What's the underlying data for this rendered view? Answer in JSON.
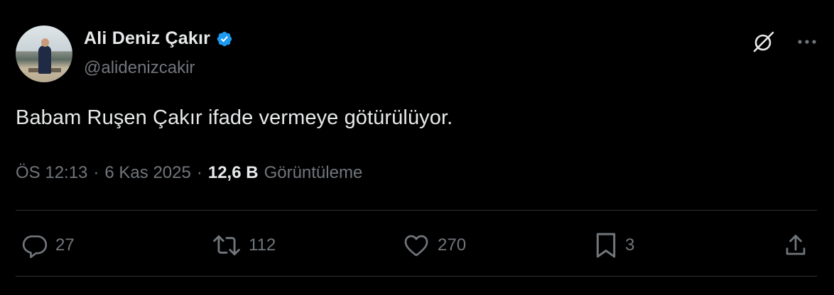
{
  "author": {
    "display_name": "Ali Deniz Çakır",
    "handle": "@alidenizcakir",
    "verified": true
  },
  "tweet": {
    "text": "Babam Ruşen Çakır ifade vermeye götürülüyor."
  },
  "meta": {
    "time": "ÖS 12:13",
    "separator": "·",
    "date": "6 Kas 2025",
    "views_count": "12,6 B",
    "views_label": "Görüntüleme"
  },
  "actions": {
    "replies": "27",
    "reposts": "112",
    "likes": "270",
    "bookmarks": "3"
  },
  "icons": {
    "verified": "verified-badge-icon",
    "grok": "grok-icon",
    "more": "more-icon",
    "reply": "reply-icon",
    "repost": "repost-icon",
    "like": "heart-icon",
    "bookmark": "bookmark-icon",
    "share": "share-icon"
  },
  "colors": {
    "background": "#000000",
    "text_primary": "#e7e9ea",
    "text_secondary": "#71767b",
    "verified_blue": "#1d9bf0",
    "divider": "#2f3336"
  }
}
